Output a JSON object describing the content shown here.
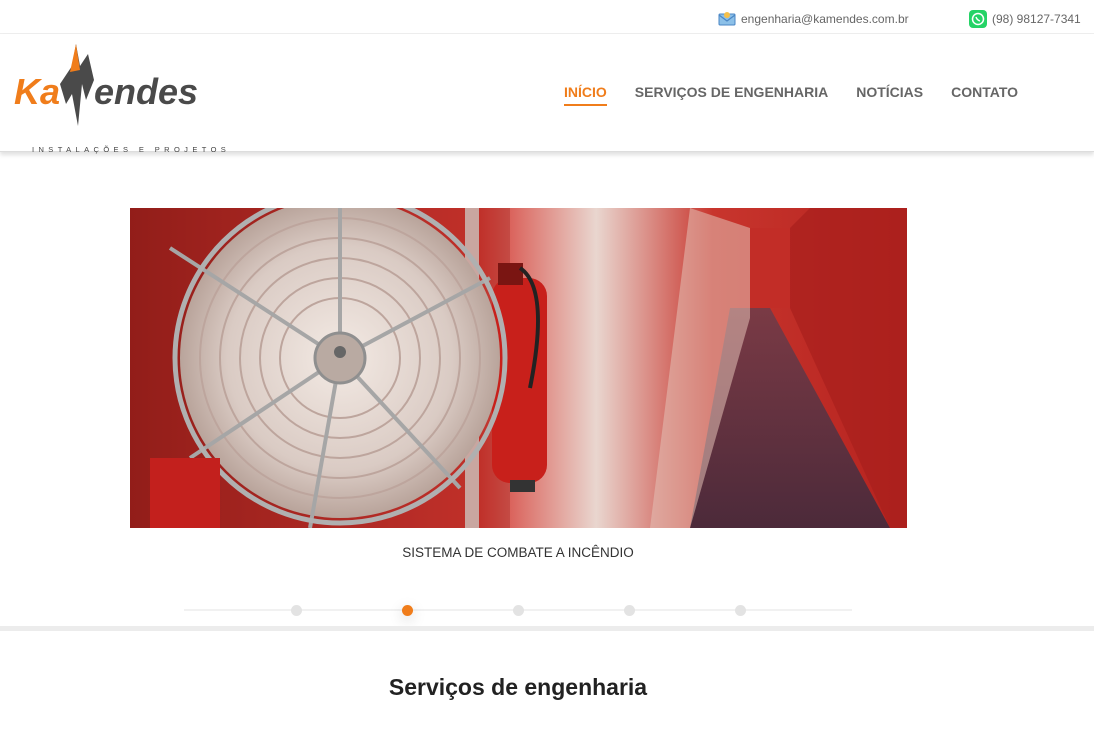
{
  "topbar": {
    "email": "engenharia@kamendes.com.br",
    "phone": "(98) 98127-7341"
  },
  "logo": {
    "name_part1": "Ka",
    "name_part2": "endes",
    "tagline": "INSTALAÇÕES E PROJETOS"
  },
  "nav": {
    "items": [
      {
        "label": "INÍCIO",
        "active": true
      },
      {
        "label": "SERVIÇOS DE ENGENHARIA",
        "active": false
      },
      {
        "label": "NOTÍCIAS",
        "active": false
      },
      {
        "label": "CONTATO",
        "active": false
      }
    ]
  },
  "slider": {
    "caption": "SISTEMA DE COMBATE A INCÊNDIO",
    "slide_count": 5,
    "active_index": 2
  },
  "section": {
    "title": "Serviços de engenharia"
  },
  "colors": {
    "accent": "#f07d1b",
    "logo_dark": "#4a4a4a",
    "whatsapp": "#25d366"
  },
  "icons": [
    "email-icon",
    "whatsapp-icon"
  ]
}
